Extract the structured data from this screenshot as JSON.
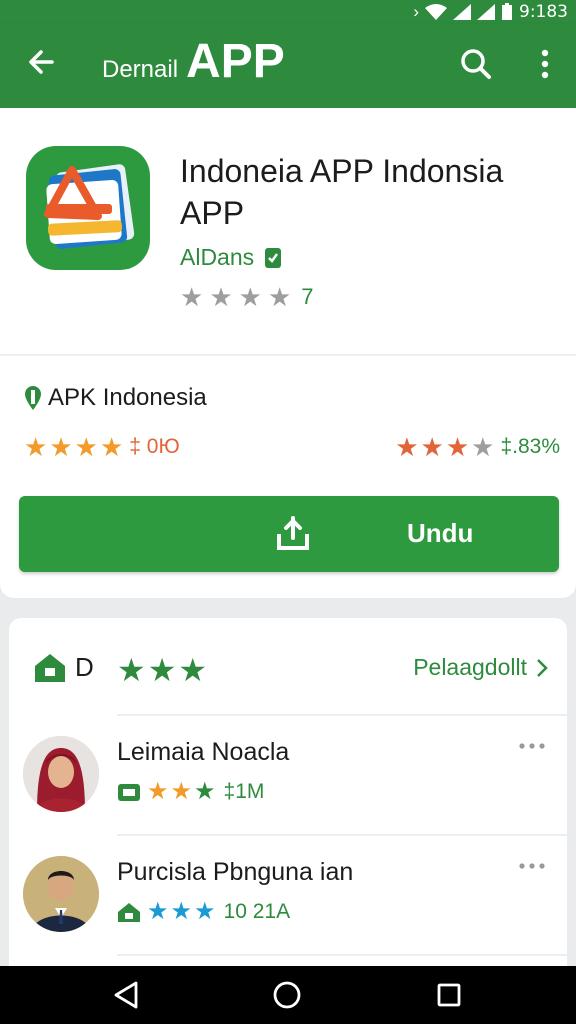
{
  "status_bar": {
    "time": "9:183"
  },
  "app_bar": {
    "title_small": "Dernail",
    "title_big": "APP"
  },
  "app": {
    "name": "Indoneia APP Indonsia APP",
    "developer": "AlDans",
    "rating_count": "7",
    "rating_stars": 3
  },
  "source": {
    "label": "APK Indonesia",
    "left_stat": "‡ 0Ю",
    "right_stat": "‡.83%"
  },
  "download": {
    "label": "Undu"
  },
  "reviews": {
    "header_letter": "D",
    "see_all": "Pelaagdollt",
    "items": [
      {
        "name": "Leimaia Noacla",
        "meta": "‡1M"
      },
      {
        "name": "Purcisla Pbnguna ian",
        "meta": "10 21A"
      }
    ]
  },
  "colors": {
    "primary_green": "#2e8b3e",
    "button_green": "#2e9a3f",
    "star_orange": "#f29b2b",
    "star_red": "#e0653a",
    "star_blue": "#1c9ad6",
    "star_gray": "#9e9e9e"
  },
  "icons": [
    "back-arrow-icon",
    "search-icon",
    "more-vert-icon",
    "verified-icon",
    "pin-icon",
    "download-icon",
    "home-icon",
    "chevron-right-icon",
    "more-horiz-icon",
    "nav-back-icon",
    "nav-home-icon",
    "nav-recent-icon"
  ]
}
